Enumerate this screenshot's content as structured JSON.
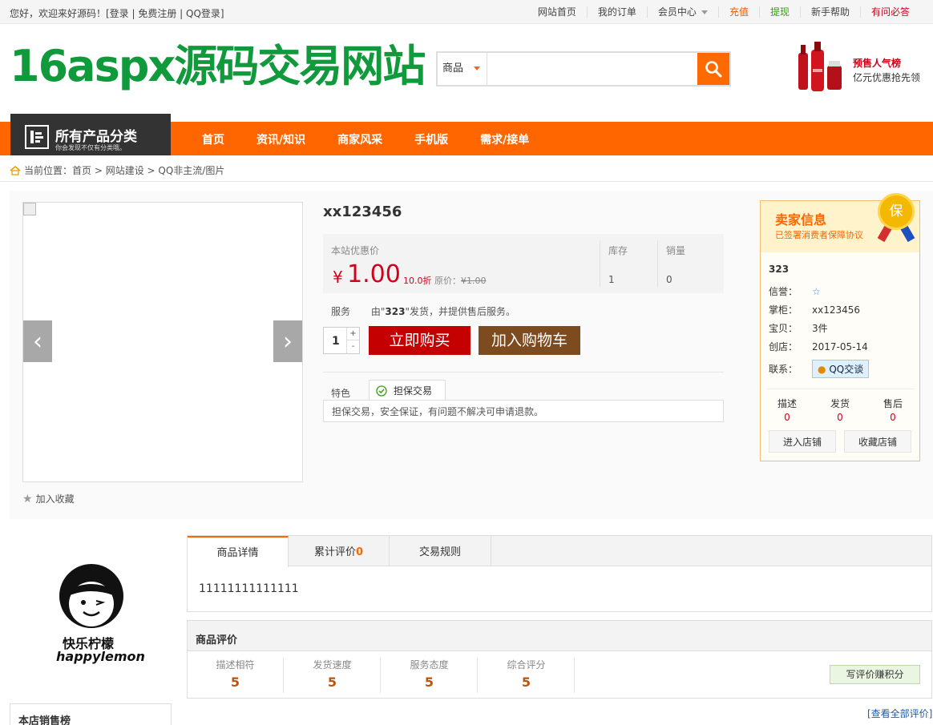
{
  "topbar": {
    "greeting": "您好，欢迎来好源码！[登录 | 免费注册 | QQ登录]",
    "links": [
      "网站首页",
      "我的订单",
      "会员中心",
      "充值",
      "提现",
      "新手帮助",
      "有问必答"
    ]
  },
  "header": {
    "logo": "16aspx源码交易网站",
    "search_category": "商品",
    "search_placeholder": "",
    "ad_line1": "预售人气榜",
    "ad_line2": "亿元优惠抢先领"
  },
  "nav": {
    "all_categories": "所有产品分类",
    "all_categories_sub": "你会发现不仅有分类哦。",
    "items": [
      "首页",
      "资讯/知识",
      "商家风采",
      "手机版",
      "需求/接单"
    ]
  },
  "breadcrumb": {
    "prefix": "当前位置：",
    "path": "首页 > 网站建设 > QQ非主流/图片"
  },
  "product": {
    "title": "xx123456",
    "price_label": "本站优惠价",
    "currency": "¥",
    "price": "1.00",
    "discount": "10.0折",
    "original_label": "原价：",
    "original_price": "¥1.00",
    "stock_label": "库存",
    "stock": "1",
    "sales_label": "销量",
    "sales": "0",
    "service_label": "服务",
    "service_pre": "由\"",
    "service_seller": "323",
    "service_post": "\"发货，并提供售后服务。",
    "quantity": "1",
    "qty_plus": "+",
    "qty_minus": "-",
    "buy_label": "立即购买",
    "cart_label": "加入购物车",
    "feature_label": "特色",
    "feature_tab": "担保交易",
    "feature_desc": "担保交易，安全保证，有问题不解决可申请退款。",
    "favorite_label": "加入收藏"
  },
  "seller": {
    "title": "卖家信息",
    "subtitle": "已签署消费者保障协议",
    "badge": "保",
    "name": "323",
    "credit_label": "信誉：",
    "shop_label": "掌柜：",
    "shop_owner": "xx123456",
    "items_label": "宝贝：",
    "items": "3件",
    "founded_label": "创店：",
    "founded": "2017-05-14",
    "contact_label": "联系：",
    "contact_button": "QQ交谈",
    "scores": [
      {
        "label": "描述",
        "value": "0"
      },
      {
        "label": "发货",
        "value": "0"
      },
      {
        "label": "售后",
        "value": "0"
      }
    ],
    "enter_shop": "进入店铺",
    "fav_shop": "收藏店铺"
  },
  "shop_logo": {
    "line1": "快乐柠檬",
    "line2": "happylemon"
  },
  "sales_rank": {
    "title": "本店销售榜"
  },
  "detail_tabs": {
    "tabs": [
      "商品详情",
      "累计评价",
      "交易规则"
    ],
    "review_count": "0",
    "content": "11111111111111"
  },
  "reviews": {
    "title": "商品评价",
    "columns": [
      {
        "label": "描述相符",
        "value": "5"
      },
      {
        "label": "发货速度",
        "value": "5"
      },
      {
        "label": "服务态度",
        "value": "5"
      },
      {
        "label": "综合评分",
        "value": "5"
      }
    ],
    "write_button": "写评价赚积分",
    "view_all": "[查看全部评价]"
  },
  "colors": {
    "accent": "#ff6600",
    "logo_green": "#109a3b",
    "price_red": "#d0021b",
    "buy_red": "#c40000",
    "cart_brown": "#7d4b1e"
  }
}
